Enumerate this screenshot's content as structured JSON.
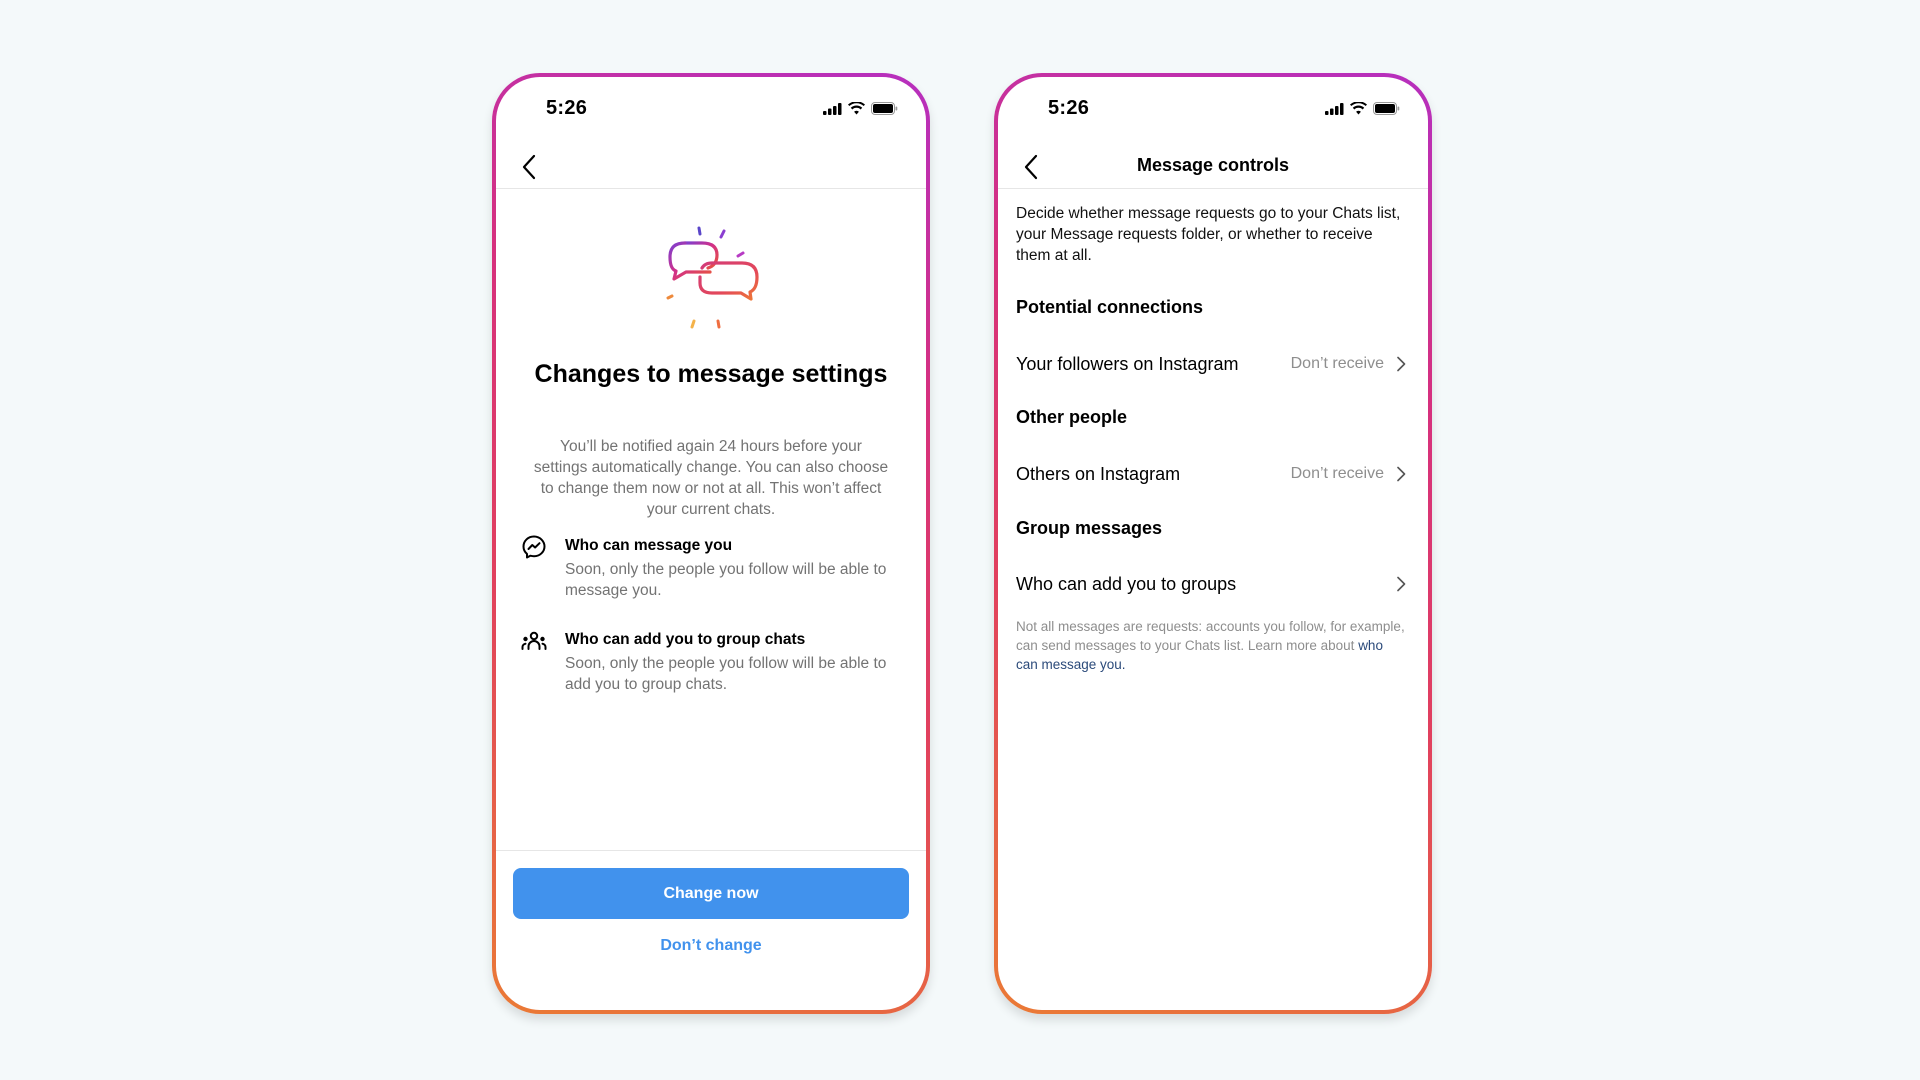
{
  "colors": {
    "background": "#f4f9fa",
    "primary_button": "#4192ed",
    "link_blue": "#4192ed",
    "footnote_link": "#2b4a7a",
    "frame_gradient": [
      "#b62fbf",
      "#d6307e",
      "#e1405e",
      "#ea7a35"
    ]
  },
  "phone1": {
    "status": {
      "time": "5:26",
      "icons": [
        "cellular-signal-icon",
        "wifi-icon",
        "battery-icon"
      ]
    },
    "header": {
      "back_icon": "chevron-left-icon"
    },
    "illustration": "chat-bubbles-sparkle-icon",
    "title": "Changes to message settings",
    "body": "You’ll be notified again 24 hours before your settings automatically change. You can also choose to change them now or not at all. This won’t affect your current chats.",
    "items": [
      {
        "icon": "messenger-icon",
        "title": "Who can message you",
        "description": "Soon, only the people you follow will be able to message you."
      },
      {
        "icon": "group-people-icon",
        "title": "Who can add you to group chats",
        "description": "Soon, only the people you follow will be able to add you to group chats."
      }
    ],
    "primary_button": "Change now",
    "secondary_button": "Don’t change"
  },
  "phone2": {
    "status": {
      "time": "5:26",
      "icons": [
        "cellular-signal-icon",
        "wifi-icon",
        "battery-icon"
      ]
    },
    "header": {
      "back_icon": "chevron-left-icon",
      "title": "Message controls"
    },
    "description": "Decide whether message requests go to your Chats list, your Message requests folder, or whether to receive them at all.",
    "sections": [
      {
        "heading": "Potential connections",
        "rows": [
          {
            "label": "Your followers on Instagram",
            "value": "Don’t receive"
          }
        ]
      },
      {
        "heading": "Other people",
        "rows": [
          {
            "label": "Others on Instagram",
            "value": "Don’t receive"
          }
        ]
      },
      {
        "heading": "Group messages",
        "rows": [
          {
            "label": "Who can add you to groups",
            "value": ""
          }
        ]
      }
    ],
    "footnote": {
      "text": "Not all messages are requests: accounts you follow, for example, can send messages to your Chats list. Learn more about ",
      "link": "who can message you."
    }
  }
}
